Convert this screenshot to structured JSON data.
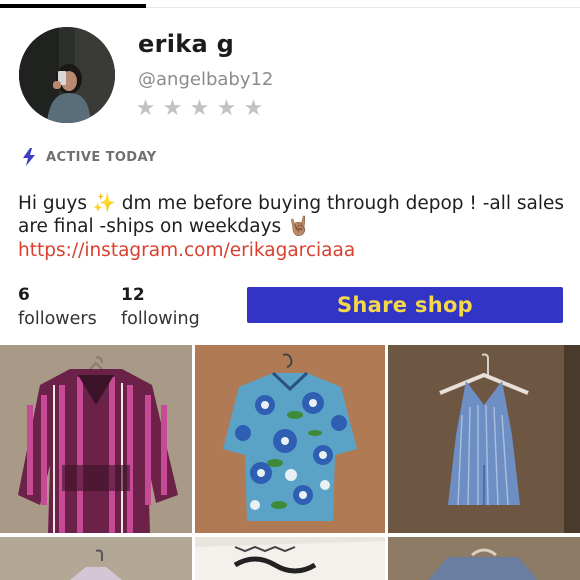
{
  "profile": {
    "name": "erika g",
    "handle": "@angelbaby12",
    "rating_stars": 0,
    "rating_max": 5,
    "activity": "ACTIVE TODAY",
    "bio": "Hi guys ✨ dm me before buying through depop ! -all sales are final -ships on weekdays 🤘🏽",
    "link": "https://instagram.com/erikagarciaaa"
  },
  "stats": {
    "followers_count": "6",
    "followers_label": "followers",
    "following_count": "12",
    "following_label": "following"
  },
  "actions": {
    "share_label": "Share shop"
  },
  "icons": {
    "activity": "lightning-bolt-icon",
    "star": "star-icon"
  },
  "colors": {
    "share_bg": "#3134c4",
    "share_text": "#f5d84a",
    "link": "#d9402f",
    "star_empty": "#c2c2c2",
    "bolt": "#3b3fc4"
  },
  "listings": [
    {
      "item": "striped-baja-hoodie"
    },
    {
      "item": "hawaiian-floral-shirt"
    },
    {
      "item": "blue-striped-halter-romper"
    },
    {
      "item": "partial-item-4"
    },
    {
      "item": "partial-item-5"
    },
    {
      "item": "partial-item-6"
    }
  ]
}
